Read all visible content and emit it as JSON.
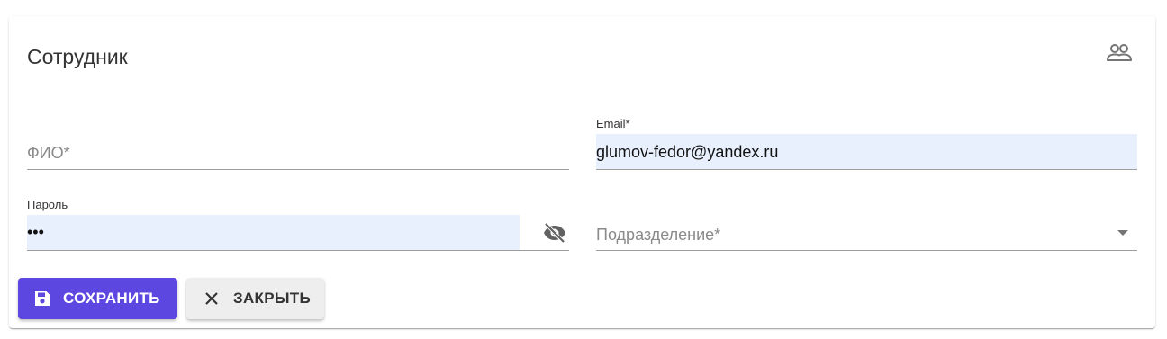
{
  "form": {
    "title": "Сотрудник",
    "header_icon": "people-icon"
  },
  "fields": {
    "fio": {
      "placeholder": "ФИО*",
      "value": ""
    },
    "email": {
      "label": "Email*",
      "value": "glumov-fedor@yandex.ru"
    },
    "password": {
      "label": "Пароль",
      "value": "•••",
      "toggle_icon": "eye-off-icon"
    },
    "department": {
      "placeholder": "Подразделение*",
      "dropdown_icon": "caret-down-icon"
    }
  },
  "actions": {
    "save_label": "СОХРАНИТЬ",
    "save_icon": "floppy-disk-icon",
    "close_label": "ЗАКРЫТЬ",
    "close_icon": "close-icon"
  },
  "colors": {
    "primary": "#5c47e0",
    "autofill_background": "#e8f0fe",
    "secondary_button": "#eeeeee"
  }
}
